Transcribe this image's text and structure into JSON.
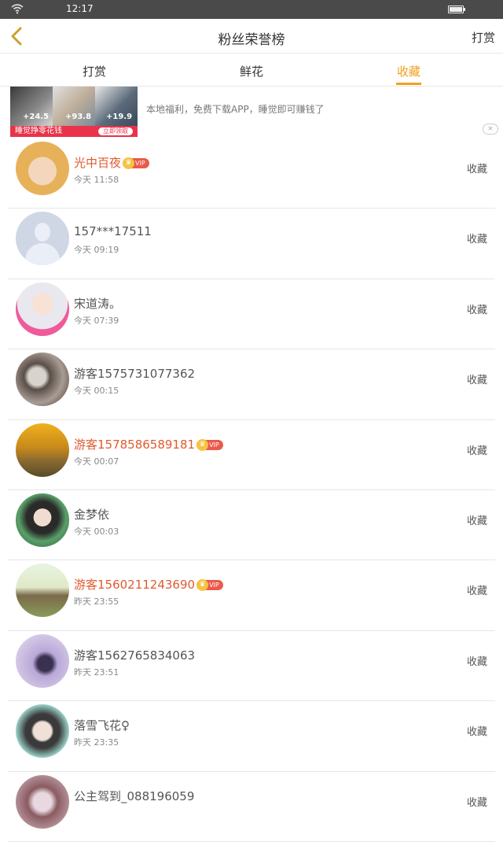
{
  "status_bar": {
    "time": "12:17"
  },
  "nav": {
    "title": "粉丝荣誉榜",
    "right_label": "打赏"
  },
  "tabs": [
    {
      "label": "打赏",
      "active": false
    },
    {
      "label": "鲜花",
      "active": false
    },
    {
      "label": "收藏",
      "active": true
    }
  ],
  "ad": {
    "numbers": [
      "+24.5",
      "+93.8",
      "+19.9"
    ],
    "banner_text": "睡觉挣零花钱",
    "banner_button": "立即领取",
    "text": "本地福利，免费下载APP，睡觉即可赚钱了",
    "close": "×"
  },
  "vip_label": "VIP",
  "list": [
    {
      "name": "光中百夜",
      "vip": true,
      "time": "今天 11:58",
      "action": "收藏"
    },
    {
      "name": "157***17511",
      "vip": false,
      "time": "今天 09:19",
      "action": "收藏"
    },
    {
      "name": "宋道涛。",
      "vip": false,
      "time": "今天 07:39",
      "action": "收藏"
    },
    {
      "name": "游客1575731077362",
      "vip": false,
      "time": "今天 00:15",
      "action": "收藏"
    },
    {
      "name": "游客1578586589181",
      "vip": true,
      "time": "今天 00:07",
      "action": "收藏"
    },
    {
      "name": "金梦依",
      "vip": false,
      "time": "今天 00:03",
      "action": "收藏"
    },
    {
      "name": "游客1560211243690",
      "vip": true,
      "time": "昨天 23:55",
      "action": "收藏"
    },
    {
      "name": "游客1562765834063",
      "vip": false,
      "time": "昨天 23:51",
      "action": "收藏"
    },
    {
      "name": "落雪飞花♀",
      "vip": false,
      "time": "昨天 23:35",
      "action": "收藏"
    },
    {
      "name": "公主驾到_088196059",
      "vip": false,
      "time": "",
      "action": "收藏"
    }
  ],
  "colors": {
    "accent": "#f0a020",
    "vip_name": "#e05a30",
    "status_bar": "#4a4a4a"
  }
}
